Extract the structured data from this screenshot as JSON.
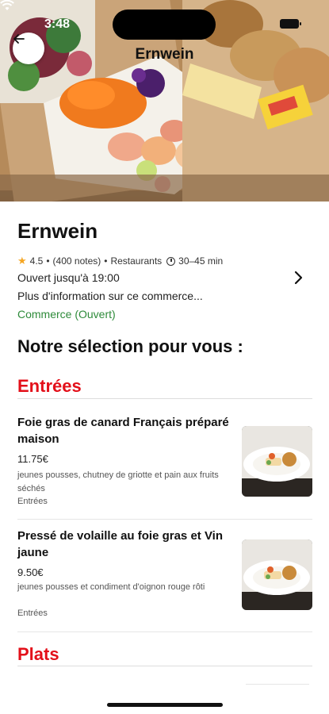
{
  "status_bar": {
    "time": "3:48"
  },
  "header": {
    "title": "Ernwein"
  },
  "store": {
    "name": "Ernwein",
    "rating": "4.5",
    "notes": "(400 notes)",
    "separator": "•",
    "category": "Restaurants",
    "delivery_time": "30–45 min",
    "hours": "Ouvert jusqu'à 19:00",
    "more_info": "Plus d'information sur ce commerce...",
    "status": "Commerce (Ouvert)"
  },
  "section_title": "Notre sélection pour vous :",
  "categories": [
    {
      "title": "Entrées"
    },
    {
      "title": "Plats"
    }
  ],
  "items": [
    {
      "name": "Foie gras de canard Français préparé maison",
      "price": "11.75€",
      "description": "jeunes pousses, chutney de griotte et pain aux fruits séchés",
      "category": "Entrées"
    },
    {
      "name": "Pressé de volaille au foie gras et Vin jaune",
      "price": "9.50€",
      "description": "jeunes pousses et condiment d'oignon rouge rôti",
      "category": "Entrées"
    }
  ],
  "colors": {
    "accent_red": "#e3101a",
    "open_green": "#2e8b3a",
    "star": "#f5a623"
  },
  "icons": {
    "back": "arrow-left-icon",
    "chevron": "chevron-right-icon",
    "star": "star-icon",
    "clock": "clock-icon"
  }
}
